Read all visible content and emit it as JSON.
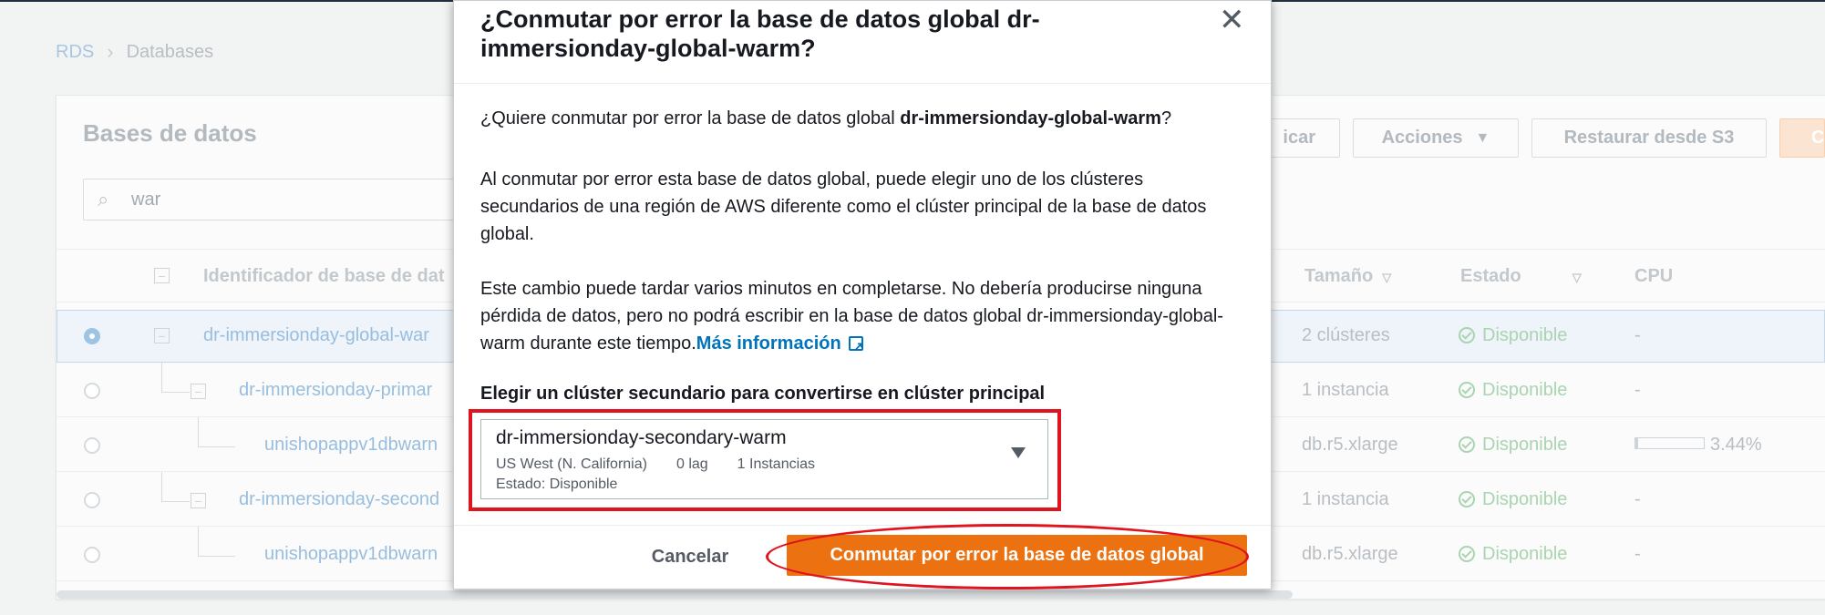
{
  "breadcrumb": {
    "root": "RDS",
    "current": "Databases"
  },
  "panel": {
    "title": "Bases de datos",
    "search_value": "war",
    "buttons": {
      "modify_partial": "icar",
      "actions": "Acciones",
      "restore_s3": "Restaurar desde S3",
      "create_partial": "C"
    }
  },
  "table": {
    "headers": {
      "identifier": "Identificador de base de dat",
      "size": "Tamaño",
      "status": "Estado",
      "cpu": "CPU"
    },
    "rows": [
      {
        "identifier": "dr-immersionday-global-war",
        "size": "2 clústeres",
        "status": "Disponible",
        "cpu": "-"
      },
      {
        "identifier": "dr-immersionday-primar",
        "size": "1 instancia",
        "status": "Disponible",
        "cpu": "-"
      },
      {
        "identifier": "unishopappv1dbwarn",
        "size": "db.r5.xlarge",
        "status": "Disponible",
        "cpu": "3.44%",
        "cpu_fraction": 0.0344
      },
      {
        "identifier": "dr-immersionday-second",
        "size": "1 instancia",
        "status": "Disponible",
        "cpu": "-"
      },
      {
        "identifier": "unishopappv1dbwarn",
        "size": "db.r5.xlarge",
        "status": "Disponible",
        "cpu": "-"
      }
    ]
  },
  "modal": {
    "title": "¿Conmutar por error la base de datos global dr-immersionday-global-warm?",
    "question_prefix": "¿Quiere conmutar por error la base de datos global ",
    "question_db": "dr-immersionday-global-warm",
    "question_suffix": "?",
    "para1": "Al conmutar por error esta base de datos global, puede elegir uno de los clústeres secundarios de una región de AWS diferente como el clúster principal de la base de datos global.",
    "para2": "Este cambio puede tardar varios minutos en completarse. No debería producirse ninguna pérdida de datos, pero no podrá escribir en la base de datos global dr-immersionday-global-warm durante este tiempo.",
    "more_info": "Más información",
    "select_label": "Elegir un clúster secundario para convertirse en clúster principal",
    "select": {
      "value": "dr-immersionday-secondary-warm",
      "region": "US West (N. California)",
      "lag": "0 lag",
      "instances": "1 Instancias",
      "status": "Estado: Disponible"
    },
    "cancel_label": "Cancelar",
    "confirm_label": "Conmutar por error la base de datos global"
  },
  "colors": {
    "primary": "#ec7211",
    "link": "#0073bb",
    "highlight": "#e0141e"
  },
  "icons": {
    "close": "close-icon",
    "search": "search-icon",
    "external": "external-link-icon",
    "status": "check-circle-icon"
  }
}
